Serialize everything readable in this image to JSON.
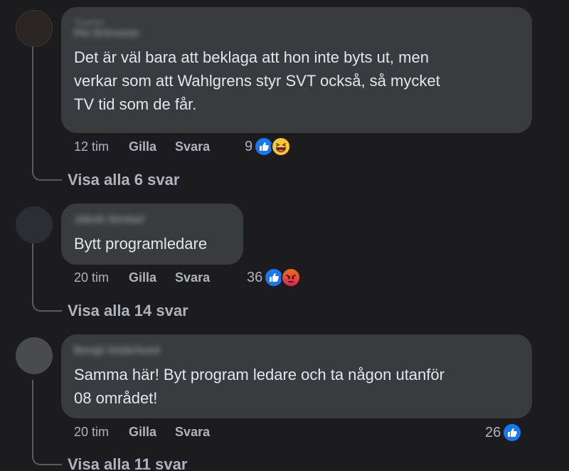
{
  "comments": [
    {
      "author": "Per Ericsson",
      "author_sub": "Toppfan",
      "text": "Det är väl bara att beklaga att hon inte byts ut, men\nverkar som att Wahlgrens styr SVT också, så mycket\nTV tid som de får.",
      "time": "12 tim",
      "like_label": "Gilla",
      "reply_label": "Svara",
      "reaction_count": "9",
      "reactions": [
        "like-icon",
        "haha-icon"
      ],
      "view_replies": "Visa alla 6 svar"
    },
    {
      "author": "Jakob Strebel",
      "text": "Bytt programledare",
      "time": "20 tim",
      "like_label": "Gilla",
      "reply_label": "Svara",
      "reaction_count": "36",
      "reactions": [
        "like-icon",
        "angry-icon"
      ],
      "view_replies": "Visa alla 14 svar"
    },
    {
      "author": "Bengt Söderlund",
      "text": "Samma här! Byt program ledare och ta någon utanför\n08 området!",
      "time": "20 tim",
      "like_label": "Gilla",
      "reply_label": "Svara",
      "reaction_count": "26",
      "reactions": [
        "like-icon"
      ],
      "view_replies": "Visa alla 11 svar"
    }
  ],
  "colors": {
    "background": "#1c1c1e",
    "bubble": "#3a3b3c",
    "text": "#e4e6eb",
    "muted": "#b0b3b8",
    "like": "#1877f2"
  }
}
